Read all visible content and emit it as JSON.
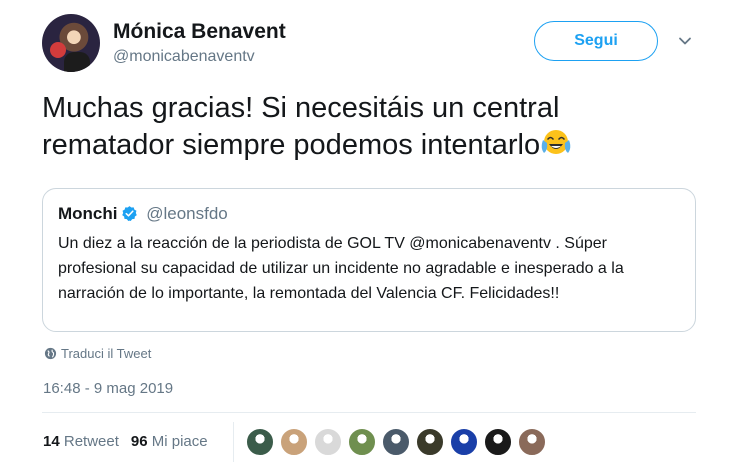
{
  "author": {
    "name": "Mónica Benavent",
    "handle": "@monicabenaventv",
    "follow_label": "Segui",
    "menu_icon": "chevron-down-icon"
  },
  "tweet": {
    "text": "Muchas gracias! Si necesitáis un central rematador siempre podemos intentarlo",
    "emoji": "face-with-tears-of-joy"
  },
  "quoted": {
    "name": "Monchi",
    "handle": "@leonsfdo",
    "verified": true,
    "text": "Un diez a la reacción de la periodista de GOL TV @monicabenaventv . Súper profesional su capacidad de utilizar un incidente no agradable e inesperado a la narración de lo importante, la remontada del Valencia CF. Felicidades!!"
  },
  "translate_label": "Traduci il Tweet",
  "timestamp": "16:48 - 9 mag 2019",
  "stats": {
    "retweets_count": "14",
    "retweets_label": "Retweet",
    "likes_count": "96",
    "likes_label": "Mi piace"
  },
  "colors": {
    "accent": "#1da1f2",
    "secondary_text": "#657786",
    "border": "#ccd6dd"
  },
  "likers": [
    {
      "name": "liker-1",
      "color": "#3b5c4a"
    },
    {
      "name": "liker-2",
      "color": "#c9a27a"
    },
    {
      "name": "liker-3",
      "color": "#d9d9d9"
    },
    {
      "name": "liker-4",
      "color": "#6f8f4f"
    },
    {
      "name": "liker-5",
      "color": "#4a5a6a"
    },
    {
      "name": "liker-6",
      "color": "#3a3a2a"
    },
    {
      "name": "liker-7",
      "color": "#1a3fa8"
    },
    {
      "name": "liker-8",
      "color": "#1a1a1a"
    },
    {
      "name": "liker-9",
      "color": "#8a6a5a"
    }
  ]
}
